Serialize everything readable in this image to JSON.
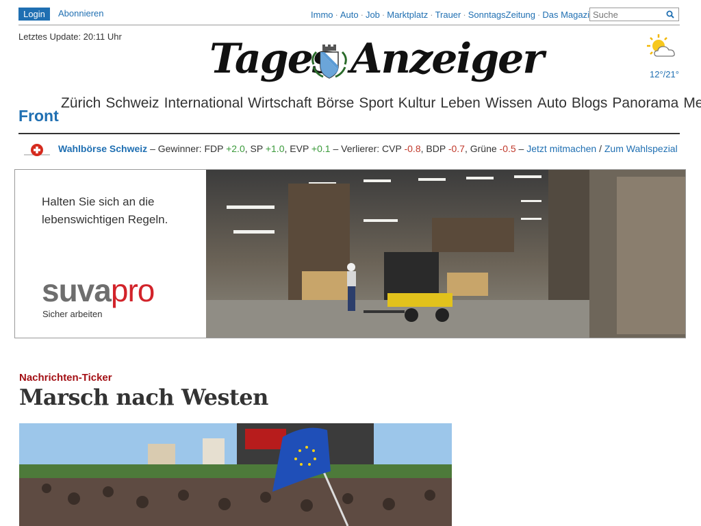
{
  "top_bar": {
    "login_label": "Login",
    "subscribe_label": "Abonnieren",
    "links": [
      "Immo",
      "Auto",
      "Job",
      "Marktplatz",
      "Trauer",
      "SonntagsZeitung",
      "Das Magazin"
    ],
    "search_placeholder": "Suche"
  },
  "last_update": "Letztes Update: 20:11 Uhr",
  "masthead": {
    "left": "Tages",
    "right": "Anzeiger"
  },
  "weather": {
    "icon": "sun-cloud-icon",
    "temperature": "12°/21°"
  },
  "main_nav": {
    "front": "Front",
    "items": [
      "Zürich",
      "Schweiz",
      "International",
      "Wirtschaft",
      "Börse",
      "Sport",
      "Kultur",
      "Leben",
      "Wissen",
      "Auto",
      "Blogs",
      "Panorama",
      "Mehr"
    ]
  },
  "wahlboerse": {
    "title": "Wahlbörse Schweiz",
    "winners_label": "– Gewinner:",
    "winners": [
      {
        "party": "FDP",
        "change": "+2.0"
      },
      {
        "party": "SP",
        "change": "+1.0"
      },
      {
        "party": "EVP",
        "change": "+0.1"
      }
    ],
    "losers_label": "– Verlierer:",
    "losers": [
      {
        "party": "CVP",
        "change": "-0.8"
      },
      {
        "party": "BDP",
        "change": "-0.7"
      },
      {
        "party": "Grüne",
        "change": "-0.5"
      }
    ],
    "link_participate": "Jetzt mitmachen",
    "link_special": "Zum Wahlspezial"
  },
  "ad": {
    "tagline": "Halten Sie sich an die lebenswichtigen Regeln.",
    "brand_part1": "suva",
    "brand_part2": "pro",
    "subline": "Sicher arbeiten"
  },
  "article": {
    "kicker": "Nachrichten-Ticker",
    "headline": "Marsch nach Westen"
  },
  "colors": {
    "link_blue": "#1f6fb2",
    "kicker_red": "#a30f14",
    "positive": "#3a9a3a",
    "negative": "#c0392b"
  }
}
